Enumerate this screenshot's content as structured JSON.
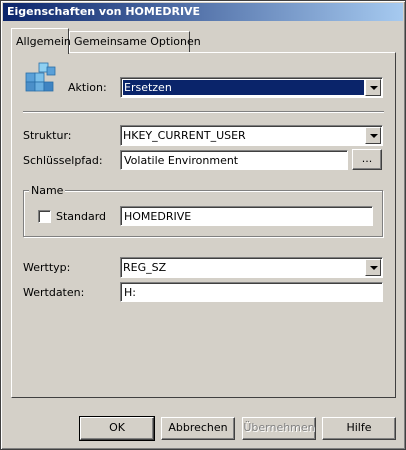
{
  "window": {
    "title": "Eigenschaften von HOMEDRIVE"
  },
  "tabs": [
    {
      "label": "Allgemein",
      "active": true
    },
    {
      "label": "Gemeinsame Optionen",
      "active": false
    }
  ],
  "icon": "registry-cubes-icon",
  "action": {
    "label": "Aktion:",
    "value": "Ersetzen"
  },
  "structure": {
    "label": "Struktur:",
    "value": "HKEY_CURRENT_USER"
  },
  "keypath": {
    "label": "Schlüsselpfad:",
    "value": "Volatile Environment",
    "browse_label": "..."
  },
  "name_group": {
    "title": "Name",
    "standard_label": "Standard",
    "standard_checked": false,
    "value": "HOMEDRIVE"
  },
  "value_type": {
    "label": "Werttyp:",
    "value": "REG_SZ"
  },
  "value_data": {
    "label": "Wertdaten:",
    "value": "H:"
  },
  "buttons": {
    "ok": "OK",
    "cancel": "Abbrechen",
    "apply": "Übernehmen",
    "help": "Hilfe"
  },
  "colors": {
    "title_bar": "#0a246a",
    "selection": "#0a246a",
    "face": "#d4d0c8"
  }
}
